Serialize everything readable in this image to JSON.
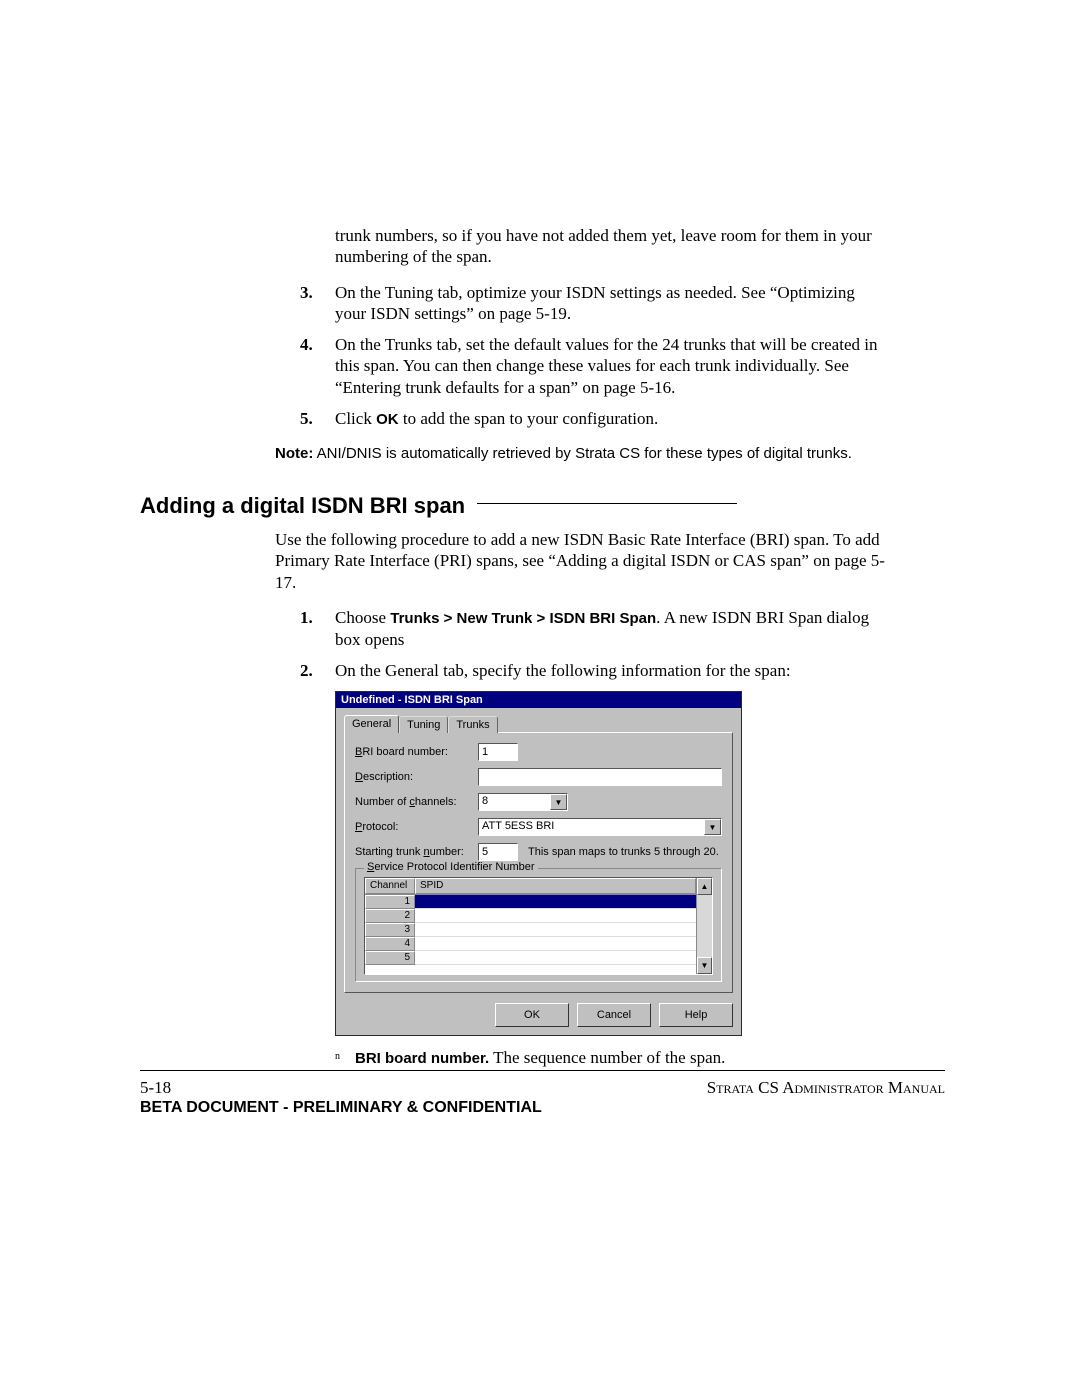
{
  "steps_top": {
    "continuation": "trunk numbers, so if you have not added them yet, leave room for them in your numbering of the span.",
    "s3_num": "3.",
    "s3": "On the Tuning tab, optimize your ISDN settings as needed. See “Optimizing your ISDN settings” on page 5-19.",
    "s4_num": "4.",
    "s4": "On the Trunks tab, set the default values for the 24 trunks that will be created in this span. You can then change these values for each trunk individually. See “Entering trunk defaults for a span” on page 5-16.",
    "s5_num": "5.",
    "s5_before": "Click ",
    "s5_ok": "OK",
    "s5_after": " to add the span to your configuration."
  },
  "note": {
    "label": "Note:",
    "text": "  ANI/DNIS is automatically retrieved by Strata CS for these types of digital trunks."
  },
  "heading": "Adding a digital ISDN BRI span",
  "intro": "Use the following procedure to add a new ISDN Basic Rate Interface (BRI) span. To add Primary Rate Interface (PRI) spans, see “Adding a digital ISDN or CAS span” on page 5-17.",
  "bri_steps": {
    "s1_num": "1.",
    "s1_before": "Choose ",
    "s1_cmd": "Trunks > New Trunk > ISDN BRI Span",
    "s1_after": ". A new ISDN BRI Span dialog box opens",
    "s2_num": "2.",
    "s2": "On the General tab, specify the following information for the span:"
  },
  "dialog": {
    "title": "Undefined - ISDN BRI Span",
    "tabs": {
      "general": "General",
      "tuning": "Tuning",
      "trunks": "Trunks"
    },
    "labels": {
      "board": "BRI board number:",
      "board_u": "B",
      "desc": "Description:",
      "desc_u": "D",
      "channels": "Number of channels:",
      "channels_u": "c",
      "protocol": "Protocol:",
      "protocol_u": "P",
      "startnum": "Starting trunk number:",
      "startnum_u": "n",
      "spin_legend": "Service Protocol Identifier Number",
      "spin_legend_u": "S"
    },
    "values": {
      "board": "1",
      "desc": "",
      "channels": "8",
      "protocol": "ATT 5ESS BRI",
      "startnum": "5",
      "maps": "This span maps to trunks 5 through 20."
    },
    "grid": {
      "col_channel": "Channel",
      "col_spid": "SPID",
      "rows": [
        "1",
        "2",
        "3",
        "4",
        "5"
      ]
    },
    "buttons": {
      "ok": "OK",
      "cancel": "Cancel",
      "help": "Help"
    }
  },
  "after_bullet": {
    "mark": "n",
    "bold": "BRI board number.",
    "rest": " The sequence number of the span."
  },
  "footer": {
    "page": "5-18",
    "right": "Strata CS Administrator Manual",
    "conf": "BETA DOCUMENT - PRELIMINARY & CONFIDENTIAL"
  }
}
